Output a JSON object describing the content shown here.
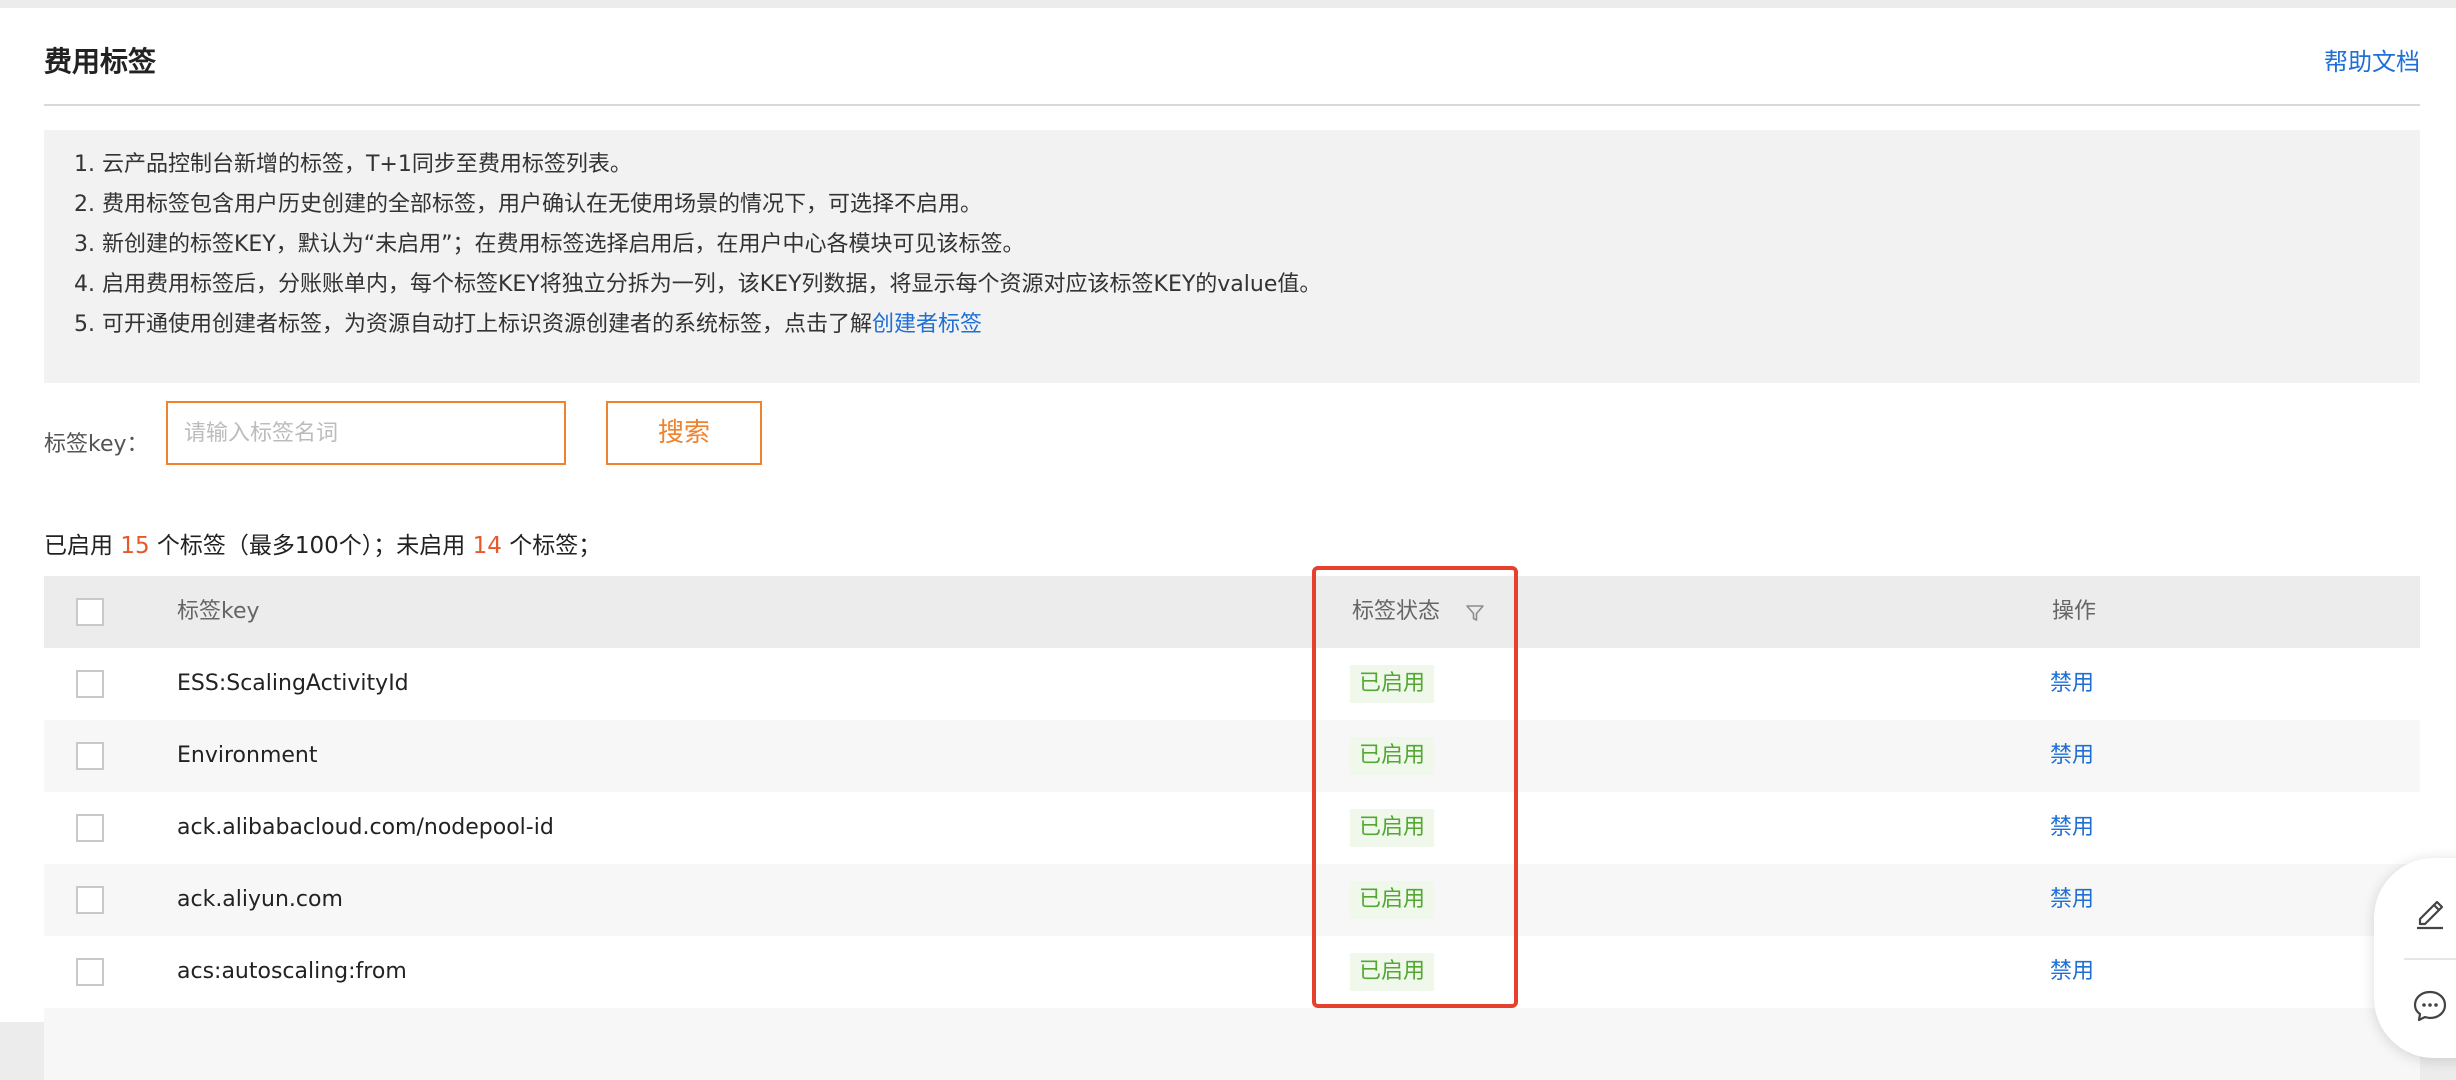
{
  "header": {
    "title": "费用标签",
    "help_link": "帮助文档"
  },
  "notice": {
    "lines": [
      "1. 云产品控制台新增的标签，T+1同步至费用标签列表。",
      "2. 费用标签包含用户历史创建的全部标签，用户确认在无使用场景的情况下，可选择不启用。",
      "3. 新创建的标签KEY，默认为“未启用”；在费用标签选择启用后，在用户中心各模块可见该标签。",
      "4. 启用费用标签后，分账账单内，每个标签KEY将独立分拆为一列，该KEY列数据，将显示每个资源对应该标签KEY的value值。"
    ],
    "line5_text": "5. 可开通使用创建者标签，为资源自动打上标识资源创建者的系统标签，点击了解",
    "line5_link": "创建者标签"
  },
  "search": {
    "label": "标签key：",
    "placeholder": "请输入标签名词",
    "value": "",
    "button_label": "搜索"
  },
  "summary": {
    "prefix": "已启用",
    "enabled_count": "15",
    "middle": "个标签（最多100个）；未启用",
    "disabled_count": "14",
    "suffix": "个标签；"
  },
  "table": {
    "columns": {
      "key": "标签key",
      "status": "标签状态",
      "ops": "操作"
    },
    "rows": [
      {
        "key": "ESS:ScalingActivityId",
        "status": "已启用",
        "action": "禁用"
      },
      {
        "key": "Environment",
        "status": "已启用",
        "action": "禁用"
      },
      {
        "key": "ack.alibabacloud.com/nodepool-id",
        "status": "已启用",
        "action": "禁用"
      },
      {
        "key": "ack.aliyun.com",
        "status": "已启用",
        "action": "禁用"
      },
      {
        "key": "acs:autoscaling:from",
        "status": "已启用",
        "action": "禁用"
      }
    ]
  },
  "icons": {
    "filter": "filter-icon",
    "edit": "edit-icon",
    "chat": "chat-icon"
  },
  "colors": {
    "accent_orange": "#f0822d",
    "link_blue": "#1f6fd6",
    "status_green": "#52a833",
    "count_red": "#e8592a",
    "highlight_red": "#e8402f"
  }
}
